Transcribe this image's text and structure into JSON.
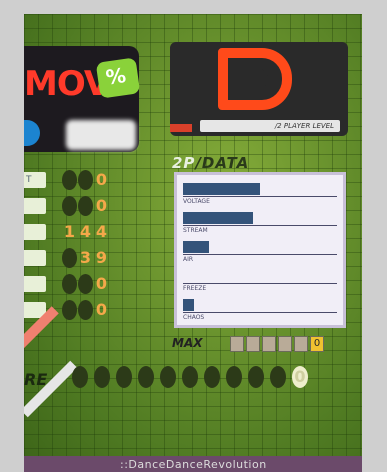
{
  "banner": {
    "title": "MOV",
    "logo_text": "%"
  },
  "grade": {
    "letter": "D",
    "caption": "/2 PLAYER LEVEL"
  },
  "judgements": [
    {
      "label": "T",
      "value": "0",
      "digits": [
        "",
        "",
        "0"
      ]
    },
    {
      "label": "",
      "value": "0",
      "digits": [
        "",
        "",
        "0"
      ]
    },
    {
      "label": "",
      "value": "144",
      "digits": [
        "1",
        "4",
        "4"
      ]
    },
    {
      "label": "",
      "value": "39",
      "digits": [
        "",
        "3",
        "9"
      ]
    },
    {
      "label": "",
      "value": "0",
      "digits": [
        "",
        "",
        "0"
      ]
    },
    {
      "label": "",
      "value": "0",
      "digits": [
        "",
        "",
        "0"
      ]
    }
  ],
  "radar": {
    "title_accent": "2P",
    "title_rest": "/DATA",
    "items": [
      {
        "name": "VOLTAGE",
        "value": 0.48
      },
      {
        "name": "STREAM",
        "value": 0.44
      },
      {
        "name": "AIR",
        "value": 0.16
      },
      {
        "name": "FREEZE",
        "value": 0.0
      },
      {
        "name": "CHAOS",
        "value": 0.07
      }
    ]
  },
  "max_combo": {
    "label": "MAX",
    "digits": [
      "",
      "",
      "",
      "",
      "",
      "0"
    ]
  },
  "score": {
    "label": "RE",
    "digits": [
      "",
      "",
      "",
      "",
      "",
      "",
      "",
      "",
      "",
      "",
      "0"
    ]
  },
  "footer": {
    "text": "::DanceDanceRevolution"
  },
  "colors": {
    "background": "#5c8a2c",
    "grade": "#ff4a1a",
    "digit": "#f4a84a",
    "radar_bar": "#34537a",
    "max_combo_lit": "#f0c230"
  }
}
